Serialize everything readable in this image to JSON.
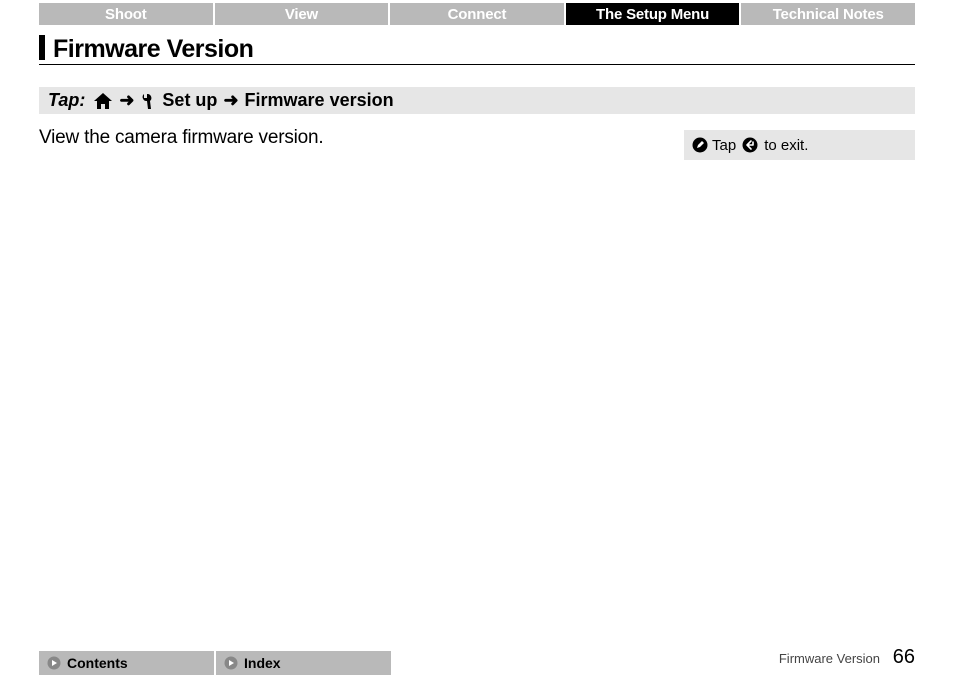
{
  "tabs": {
    "shoot": "Shoot",
    "view": "View",
    "connect": "Connect",
    "setup": "The Setup Menu",
    "tech": "Technical Notes"
  },
  "heading": "Firmware Version",
  "breadcrumb": {
    "tap_label": "Tap:",
    "setup": "Set up",
    "firmware": "Firmware version",
    "arrow": "➜"
  },
  "body": "View the camera firmware version.",
  "tip": {
    "prefix": "Tap",
    "suffix": "to exit."
  },
  "footer": {
    "contents": "Contents",
    "index": "Index",
    "title": "Firmware Version",
    "page": "66"
  },
  "icons": {
    "home": "home-icon",
    "wrench": "wrench-icon",
    "pencil": "pencil-icon",
    "back": "back-circle-icon",
    "go": "go-circle-icon"
  }
}
